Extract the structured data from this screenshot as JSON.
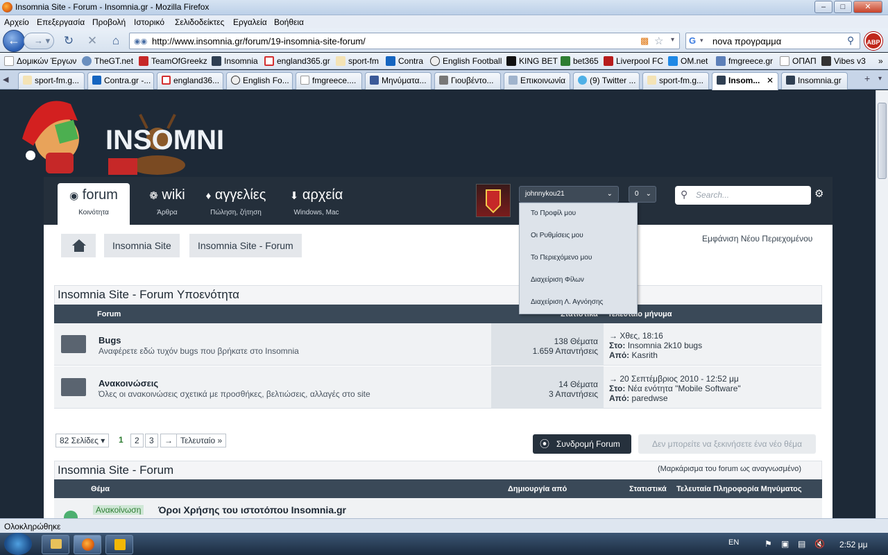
{
  "window": {
    "title": "Insomnia Site - Forum - Insomnia.gr - Mozilla Firefox",
    "controls": [
      "minimize",
      "maximize",
      "close"
    ]
  },
  "menu": [
    "Αρχείο",
    "Επεξεργασία",
    "Προβολή",
    "Ιστορικό",
    "Σελιδοδείκτες",
    "Εργαλεία",
    "Βοήθεια"
  ],
  "address": {
    "url": "http://www.insomnia.gr/forum/19-insomnia-site-forum/",
    "search_value": "nova προγραμμα"
  },
  "abp_label": "ABP",
  "bookmarks": [
    "Δομικών Έργων",
    "TheGT.net",
    "TeamOfGreekz",
    "Insomnia",
    "england365.gr",
    "sport-fm",
    "Contra",
    "English Football",
    "KING BET",
    "bet365",
    "Liverpool FC",
    "OM.net",
    "fmgreece.gr",
    "ΟΠΑΠ",
    "Vibes v3"
  ],
  "tabs": [
    "sport-fm.g...",
    "Contra.gr -...",
    "england36...",
    "English Fo...",
    "fmgreece....",
    "Μηνύματα...",
    "Γιουβέντο...",
    "Επικοινωνία",
    "(9) Twitter ...",
    "sport-fm.g...",
    "Insom...",
    "Insomnia.gr"
  ],
  "site": {
    "logo_text": "INSOMNIA",
    "nav": [
      {
        "label": "forum",
        "sub": "Κοινότητα"
      },
      {
        "label": "wiki",
        "sub": "Άρθρα"
      },
      {
        "label": "αγγελίες",
        "sub": "Πώληση, ζήτηση"
      },
      {
        "label": "αρχεία",
        "sub": "Windows, Mac"
      }
    ],
    "username": "johnnykou21",
    "notif_count": "0",
    "search_placeholder": "Search...",
    "user_menu": [
      "Το Προφίλ μου",
      "Οι Ρυθμίσεις μου",
      "Το Περιεχόμενο μου",
      "Διαχείριση Φίλων",
      "Διαχείριση Λ. Αγνόησης"
    ]
  },
  "breadcrumb": [
    "Insomnia Site",
    "Insomnia Site - Forum"
  ],
  "new_content_link": "Εμφάνιση Νέου Περιεχομένου",
  "subforum_section": {
    "title": "Insomnia Site - Forum Υποενότητα",
    "headers": {
      "forum": "Forum",
      "stats": "Στατιστικά",
      "last": "Τελευταίο μήνυμα"
    },
    "rows": [
      {
        "title": "Bugs",
        "desc": "Αναφέρετε εδώ τυχόν bugs που βρήκατε στο Insomnia",
        "topics": "138 Θέματα",
        "replies": "1.659 Απαντήσεις",
        "last_date": "Χθες, 18:16",
        "last_in_label": "Στο:",
        "last_in": "Insomnia 2k10 bugs",
        "last_by_label": "Από:",
        "last_by": "Kasrith"
      },
      {
        "title": "Ανακοινώσεις",
        "desc": "Όλες οι ανακοινώσεις σχετικά με προσθήκες, βελτιώσεις, αλλαγές στο site",
        "topics": "14 Θέματα",
        "replies": "3 Απαντήσεις",
        "last_date": "20 Σεπτέμβριος 2010 - 12:52 μμ",
        "last_in_label": "Στο:",
        "last_in": "Νέα ενότητα \"Mobile Software\"",
        "last_by_label": "Από:",
        "last_by": "paredwse"
      }
    ]
  },
  "pagination": {
    "pages_label": "82 Σελίδες",
    "pages": [
      "1",
      "2",
      "3"
    ],
    "next": "→",
    "last": "Τελευταίο »"
  },
  "buttons": {
    "subscribe": "Συνδρομή Forum",
    "new_thread": "Δεν μπορείτε να ξεκινήσετε ένα νέο θέμα"
  },
  "topics_section": {
    "title": "Insomnia Site - Forum",
    "mark_read": "(Μαρκάρισμα του forum ως αναγνωσμένο)",
    "headers": {
      "topic": "Θέμα",
      "creator": "Δημιουργία από",
      "stats": "Στατιστικά",
      "last_info": "Τελευταία Πληροφορία Μηνύματος"
    },
    "first_topic": {
      "badge": "Ανακοίνωση",
      "title": "Όροι Χρήσης του ιστοτόπου Insomnia.gr"
    }
  },
  "status_text": "Ολοκληρώθηκε",
  "taskbar": {
    "lang": "EN",
    "time": "2:52 μμ"
  }
}
